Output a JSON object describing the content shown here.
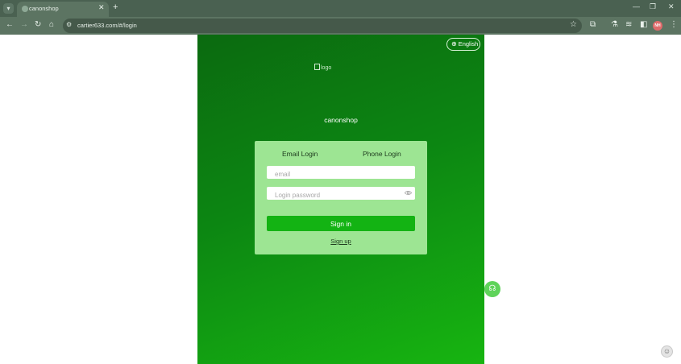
{
  "browser": {
    "tab_title": "canonshop",
    "url": "cartier633.com/#/login",
    "profile_initials": "NH",
    "icons": {
      "tab_search": "▾",
      "tab_close": "✕",
      "new_tab": "+",
      "minimize": "—",
      "restore": "❐",
      "close": "✕",
      "back": "←",
      "forward": "→",
      "reload": "↻",
      "home": "⌂",
      "site_info": "⚙",
      "bookmark": "☆",
      "extensions": "⧉",
      "labs": "⚗",
      "media": "≋",
      "side_panel": "◧",
      "menu": "⋮"
    }
  },
  "page": {
    "language_label": "English",
    "logo_alt": "logo",
    "brand_name": "canonshop",
    "login_tabs": [
      "Email Login",
      "Phone Login"
    ],
    "email_placeholder": "email",
    "password_placeholder": "Login password",
    "signin_label": "Sign in",
    "signup_label": "Sign up",
    "support_icon": "☊",
    "corner_icon": "☺"
  },
  "colors": {
    "gradient_start": "#0b6a10",
    "gradient_end": "#17b511",
    "card_bg": "#9de593",
    "button_bg": "#13b313",
    "chrome_dark": "#4a6151",
    "chrome_toolbar": "#5c7462"
  }
}
